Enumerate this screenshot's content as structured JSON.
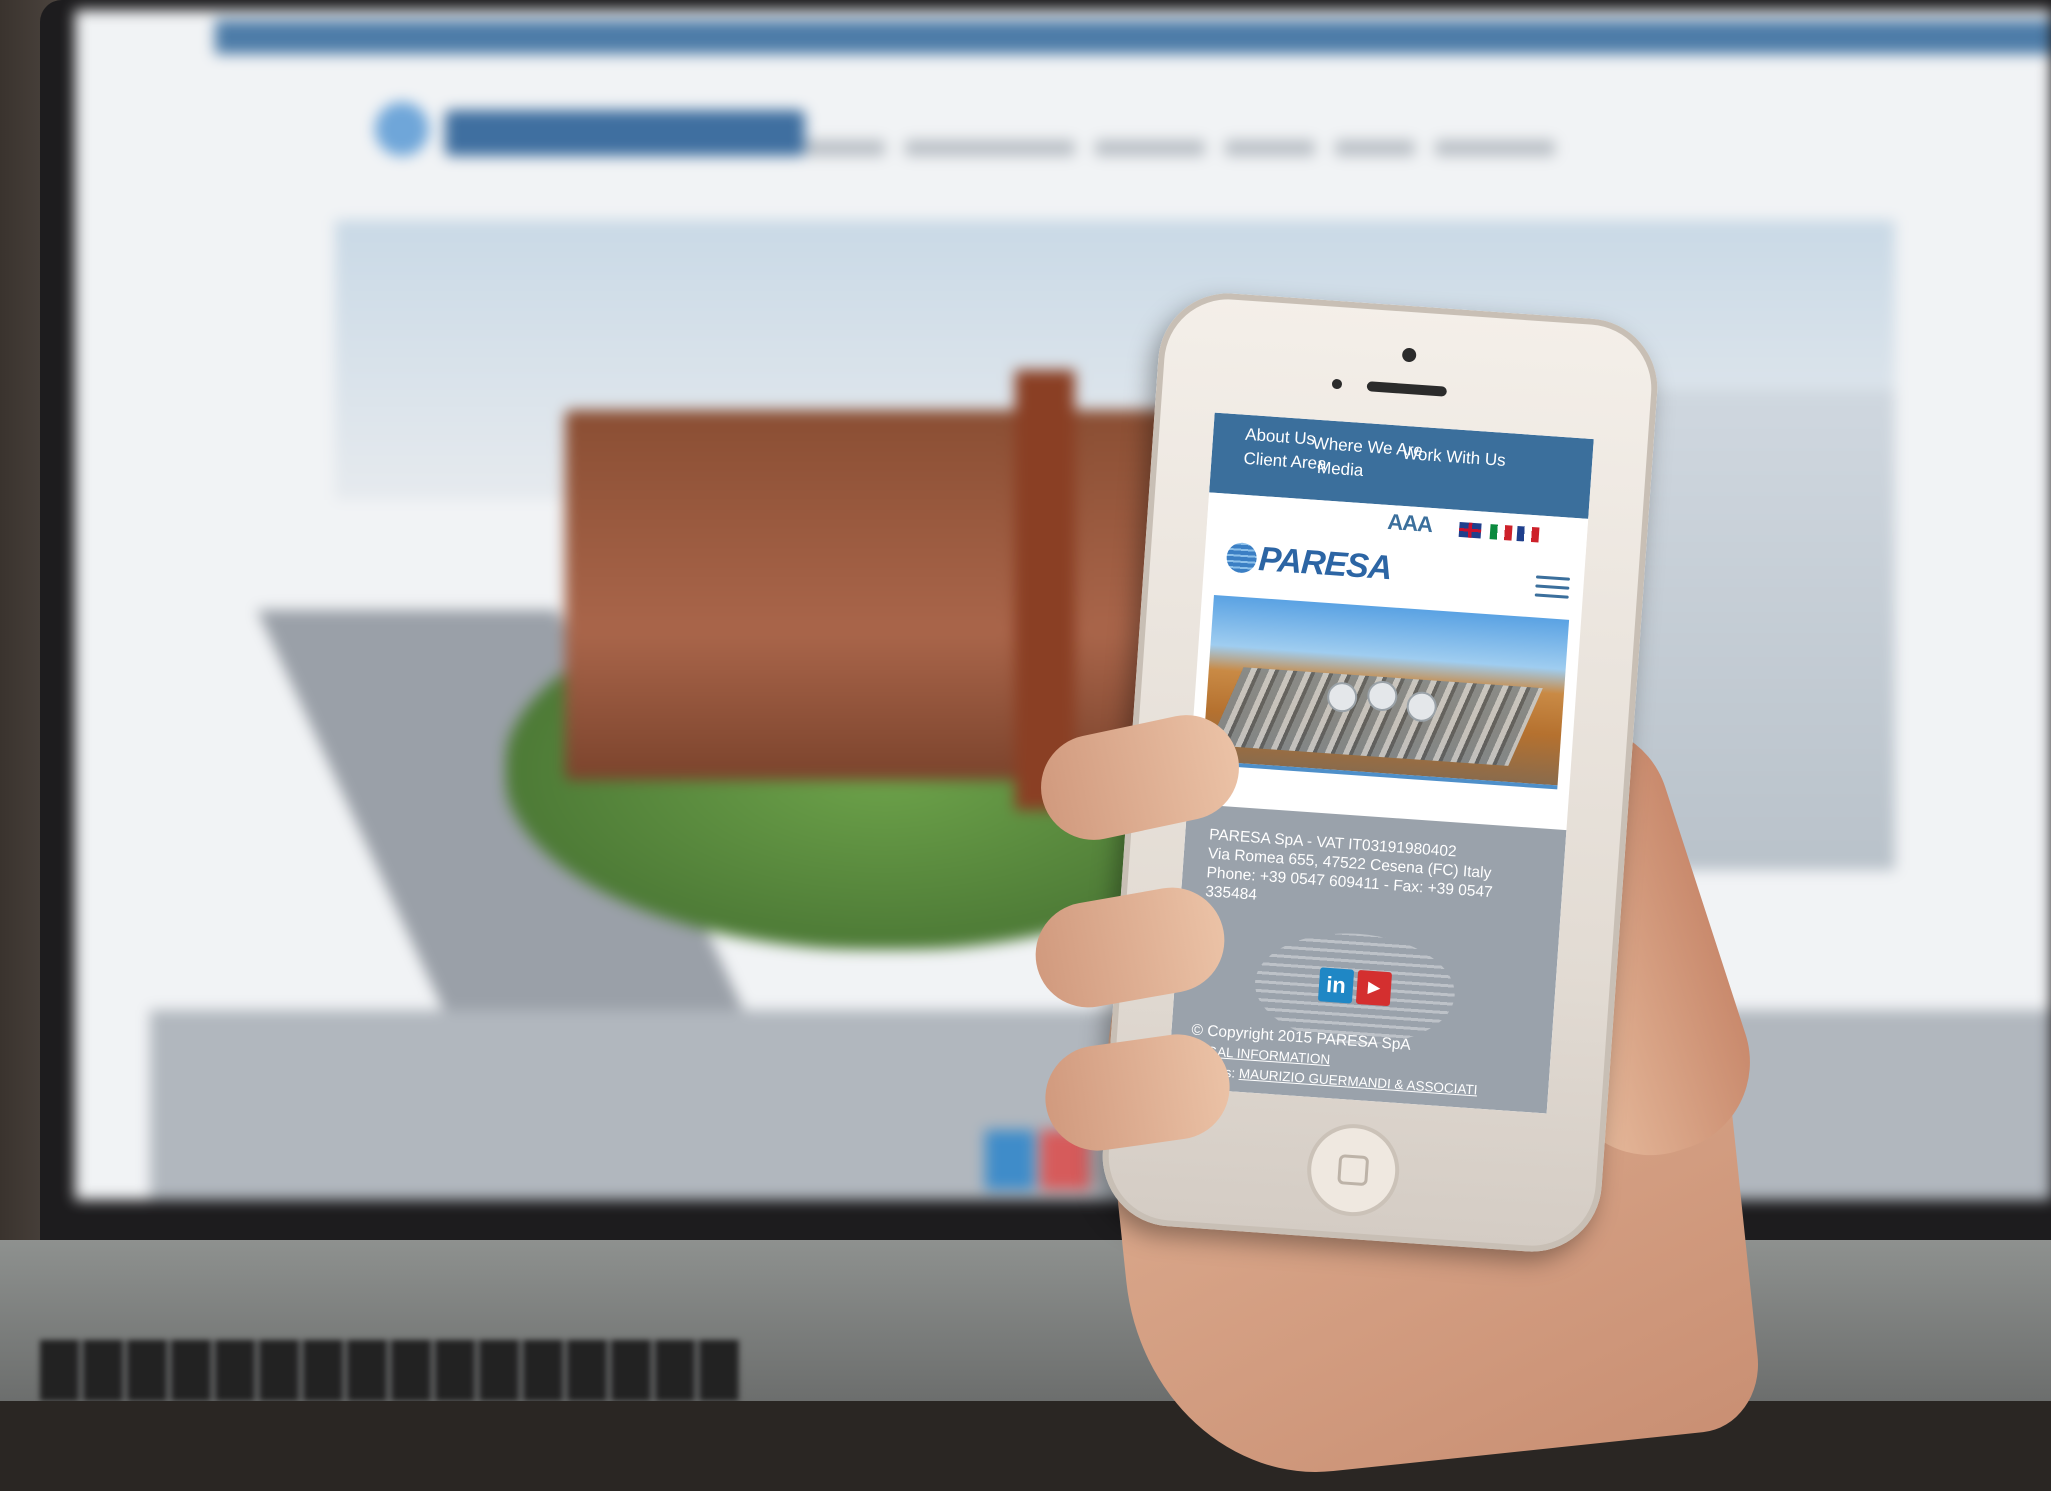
{
  "phone_site": {
    "nav": {
      "about_us": "About Us",
      "where_we_are": "Where We Are",
      "work_with_us": "Work With Us",
      "client_area": "Client Area",
      "media": "Media"
    },
    "font_size_control": "AAA",
    "languages": [
      "uk-flag",
      "italy-flag",
      "france-flag"
    ],
    "logo_text": "PARESA",
    "menu_icon": "hamburger-menu-icon",
    "footer": {
      "line1": "PARESA SpA - VAT IT03191980402",
      "line2": "Via Romea 655, 47522 Cesena (FC) Italy",
      "line3": "Phone: +39 0547 609411 - Fax: +39 0547",
      "line4": "335484",
      "linkedin_label": "in",
      "youtube_label": "▶",
      "copyright": "© Copyright 2015 PARESA SpA",
      "legal": "LEGAL INFORMATION",
      "credits_label": "Credits:",
      "credits_link": "MAURIZIO GUERMANDI & ASSOCIATI"
    }
  },
  "colors": {
    "nav_blue": "#3b6f9c",
    "footer_gray": "#9aa2ab",
    "logo_blue": "#2c65a4"
  }
}
